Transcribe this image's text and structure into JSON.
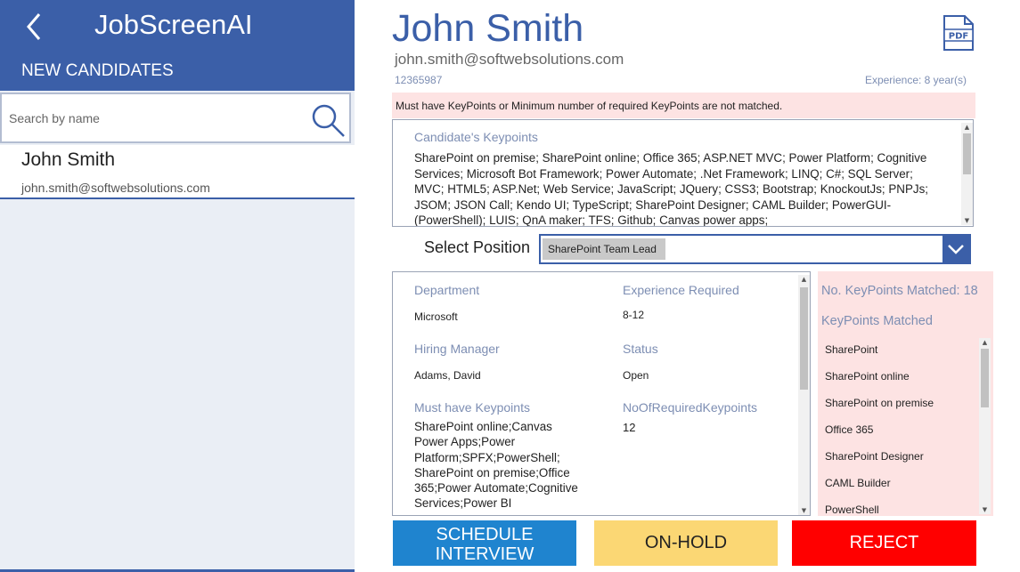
{
  "app": {
    "title": "JobScreenAI",
    "section_title": "NEW CANDIDATES"
  },
  "search": {
    "placeholder": "Search by name"
  },
  "candidates": [
    {
      "name": "John Smith",
      "email": "john.smith@softwebsolutions.com"
    }
  ],
  "candidate": {
    "name": "John Smith",
    "email": "john.smith@softwebsolutions.com",
    "phone": "12365987",
    "experience": "Experience: 8 year(s)"
  },
  "warning": "Must have KeyPoints or Minimum number of required KeyPoints are not matched.",
  "keypoints": {
    "title": "Candidate's Keypoints",
    "text": "SharePoint on premise; SharePoint online; Office 365; ASP.NET MVC; Power Platform; Cognitive Services; Microsoft Bot Framework; Power Automate; .Net Framework; LINQ; C#; SQL Server; MVC; HTML5; ASP.Net; Web Service; JavaScript; JQuery; CSS3; Bootstrap; KnockoutJs; PNPJs; JSOM; JSON Call; Kendo UI; TypeScript; SharePoint Designer; CAML Builder; PowerGUI-(PowerShell); LUIS; QnA maker; TFS; Github; Canvas power apps;"
  },
  "position": {
    "label": "Select Position",
    "selected": "SharePoint Team Lead"
  },
  "details": {
    "department_label": "Department",
    "department": "Microsoft",
    "experience_label": "Experience Required",
    "experience": "8-12",
    "hiring_manager_label": "Hiring Manager",
    "hiring_manager": "Adams, David",
    "status_label": "Status",
    "status": "Open",
    "must_have_label": "Must have Keypoints",
    "must_have": "SharePoint online;Canvas Power Apps;Power Platform;SPFX;PowerShell; SharePoint on premise;Office 365;Power Automate;Cognitive Services;Power BI",
    "required_count_label": "NoOfRequiredKeypoints",
    "required_count": "12"
  },
  "matched": {
    "count_text": "No. KeyPoints Matched: 18",
    "title": "KeyPoints Matched",
    "items": [
      "SharePoint",
      "SharePoint online",
      "SharePoint on premise",
      "Office 365",
      "SharePoint Designer",
      "CAML Builder",
      "PowerShell"
    ]
  },
  "actions": {
    "schedule": "SCHEDULE INTERVIEW",
    "onhold": "ON-HOLD",
    "reject": "REJECT"
  },
  "colors": {
    "brand": "#3b5fa8",
    "label": "#7d8eb3",
    "warning_bg": "#fde3e3",
    "schedule": "#1f84cf",
    "onhold": "#fbd774",
    "reject": "#ff0000"
  },
  "icons": [
    "back-chevron-icon",
    "search-icon",
    "pdf-icon",
    "chevron-down-icon"
  ]
}
